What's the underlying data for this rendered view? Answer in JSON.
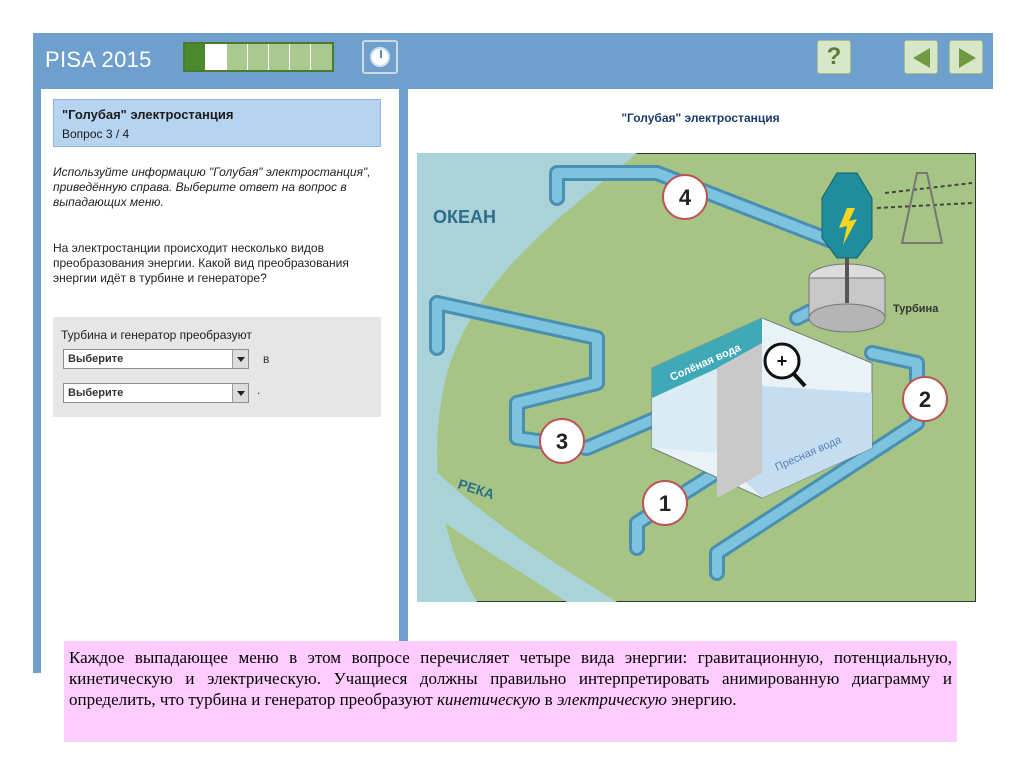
{
  "app": {
    "title": "PISA 2015"
  },
  "progress": {
    "total": 7,
    "completed": 1,
    "current": 2
  },
  "toolbar": {
    "help_label": "?"
  },
  "left": {
    "unit_title": "\"Голубая\" электростанция",
    "question_num": "Вопрос 3 / 4",
    "instruction": "Используйте информацию \"Голубая\" электростанция\", приведённую справа. Выберите ответ на вопрос в выпадающих меню.",
    "question": "На электростанции происходит несколько видов преобразования энергии. Какой вид преобразования энергии идёт в турбине и генераторе?",
    "answer_lead": "Турбина и генератор преобразуют",
    "select1": "Выберите",
    "connector_v": "в",
    "select2": "Выберите",
    "connector_dot": "."
  },
  "stimulus": {
    "title": "\"Голубая\" электростанция",
    "labels": {
      "ocean": "ОКЕАН",
      "river": "РЕКА",
      "salt_water": "Солёная вода",
      "fresh_water": "Пресная вода",
      "turbine": "Турбина",
      "steps": [
        "1",
        "2",
        "3",
        "4"
      ]
    }
  },
  "note": {
    "part1": "Каждое выпадающее меню в этом вопросе перечисляет четыре вида энергии: гравитационную, потенциальную, кинетическую и электрическую. Учащиеся должны правильно интерпретировать анимированную диаграмму и определить, что турбина и генератор преобразуют ",
    "italic1": "кинетическую",
    "part2": " в ",
    "italic2": "электрическую",
    "part3": " энергию."
  },
  "colors": {
    "frame": "#6f9fcd",
    "ocean": "#a9d3d9",
    "land": "#a6c585",
    "pipe": "#6fb6d3",
    "note_bg": "#ffccff"
  }
}
